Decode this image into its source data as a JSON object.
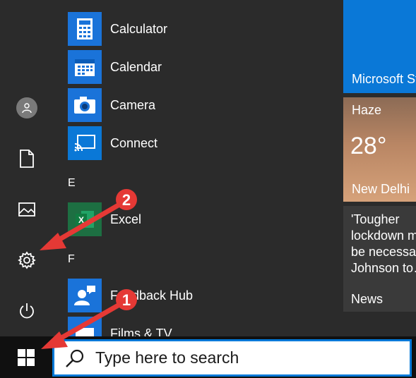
{
  "rail": {
    "items": [
      {
        "name": "user-account",
        "icon": "person-icon"
      },
      {
        "name": "documents",
        "icon": "document-icon"
      },
      {
        "name": "pictures",
        "icon": "picture-icon"
      },
      {
        "name": "settings",
        "icon": "gear-icon"
      },
      {
        "name": "power",
        "icon": "power-icon"
      }
    ]
  },
  "applist": {
    "apps": [
      {
        "label": "Calculator",
        "icon": "calculator-icon",
        "color": "#1a73d9"
      },
      {
        "label": "Calendar",
        "icon": "calendar-icon",
        "color": "#1a73d9"
      },
      {
        "label": "Camera",
        "icon": "camera-icon",
        "color": "#1a73d9"
      },
      {
        "label": "Connect",
        "icon": "connect-icon",
        "color": "#0a78d7"
      },
      {
        "label": "Excel",
        "icon": "excel-icon",
        "color": "#1d6f42"
      },
      {
        "label": "Feedback Hub",
        "icon": "feedback-icon",
        "color": "#1a73d9"
      },
      {
        "label": "Films & TV",
        "icon": "films-icon",
        "color": "#1a73d9"
      }
    ],
    "letters": [
      "E",
      "F"
    ]
  },
  "tiles": {
    "store": {
      "label": "Microsoft Store",
      "color": "#0a78d7"
    },
    "weather": {
      "condition": "Haze",
      "temperature": "28°",
      "city": "New Delhi"
    },
    "news": {
      "headline": "'Tougher\nlockdown m\nbe necessar\nJohnson to…",
      "label": "News"
    }
  },
  "taskbar": {
    "search_placeholder": "Type here to search",
    "accent": "#0078d7"
  },
  "annotations": {
    "badges": [
      "1",
      "2"
    ],
    "color": "#e53935"
  }
}
